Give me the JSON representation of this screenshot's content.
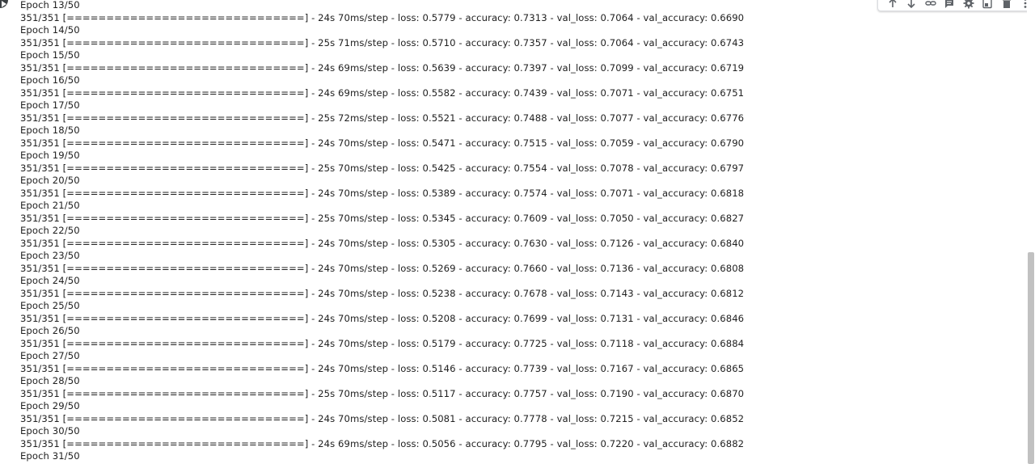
{
  "log_lines": [
    "Epoch 13/50",
    "351/351 [==============================] - 24s 70ms/step - loss: 0.5779 - accuracy: 0.7313 - val_loss: 0.7064 - val_accuracy: 0.6690",
    "Epoch 14/50",
    "351/351 [==============================] - 25s 71ms/step - loss: 0.5710 - accuracy: 0.7357 - val_loss: 0.7064 - val_accuracy: 0.6743",
    "Epoch 15/50",
    "351/351 [==============================] - 24s 69ms/step - loss: 0.5639 - accuracy: 0.7397 - val_loss: 0.7099 - val_accuracy: 0.6719",
    "Epoch 16/50",
    "351/351 [==============================] - 24s 69ms/step - loss: 0.5582 - accuracy: 0.7439 - val_loss: 0.7071 - val_accuracy: 0.6751",
    "Epoch 17/50",
    "351/351 [==============================] - 25s 72ms/step - loss: 0.5521 - accuracy: 0.7488 - val_loss: 0.7077 - val_accuracy: 0.6776",
    "Epoch 18/50",
    "351/351 [==============================] - 24s 70ms/step - loss: 0.5471 - accuracy: 0.7515 - val_loss: 0.7059 - val_accuracy: 0.6790",
    "Epoch 19/50",
    "351/351 [==============================] - 25s 70ms/step - loss: 0.5425 - accuracy: 0.7554 - val_loss: 0.7078 - val_accuracy: 0.6797",
    "Epoch 20/50",
    "351/351 [==============================] - 24s 70ms/step - loss: 0.5389 - accuracy: 0.7574 - val_loss: 0.7071 - val_accuracy: 0.6818",
    "Epoch 21/50",
    "351/351 [==============================] - 25s 70ms/step - loss: 0.5345 - accuracy: 0.7609 - val_loss: 0.7050 - val_accuracy: 0.6827",
    "Epoch 22/50",
    "351/351 [==============================] - 24s 70ms/step - loss: 0.5305 - accuracy: 0.7630 - val_loss: 0.7126 - val_accuracy: 0.6840",
    "Epoch 23/50",
    "351/351 [==============================] - 24s 70ms/step - loss: 0.5269 - accuracy: 0.7660 - val_loss: 0.7136 - val_accuracy: 0.6808",
    "Epoch 24/50",
    "351/351 [==============================] - 24s 70ms/step - loss: 0.5238 - accuracy: 0.7678 - val_loss: 0.7143 - val_accuracy: 0.6812",
    "Epoch 25/50",
    "351/351 [==============================] - 24s 70ms/step - loss: 0.5208 - accuracy: 0.7699 - val_loss: 0.7131 - val_accuracy: 0.6846",
    "Epoch 26/50",
    "351/351 [==============================] - 24s 70ms/step - loss: 0.5179 - accuracy: 0.7725 - val_loss: 0.7118 - val_accuracy: 0.6884",
    "Epoch 27/50",
    "351/351 [==============================] - 24s 70ms/step - loss: 0.5146 - accuracy: 0.7739 - val_loss: 0.7167 - val_accuracy: 0.6865",
    "Epoch 28/50",
    "351/351 [==============================] - 25s 70ms/step - loss: 0.5117 - accuracy: 0.7757 - val_loss: 0.7190 - val_accuracy: 0.6870",
    "Epoch 29/50",
    "351/351 [==============================] - 24s 70ms/step - loss: 0.5081 - accuracy: 0.7778 - val_loss: 0.7215 - val_accuracy: 0.6852",
    "Epoch 30/50",
    "351/351 [==============================] - 24s 69ms/step - loss: 0.5056 - accuracy: 0.7795 - val_loss: 0.7220 - val_accuracy: 0.6882",
    "Epoch 31/50"
  ],
  "toolbar": {
    "icons": [
      "arrow-up-icon",
      "arrow-down-icon",
      "link-icon",
      "comment-icon",
      "gear-icon",
      "mirror-cell-icon",
      "delete-icon",
      "more-vert-icon"
    ]
  },
  "colors": {
    "text": "#212121",
    "icon": "#5f6368",
    "scrollbar_thumb": "#c1c1c1"
  }
}
